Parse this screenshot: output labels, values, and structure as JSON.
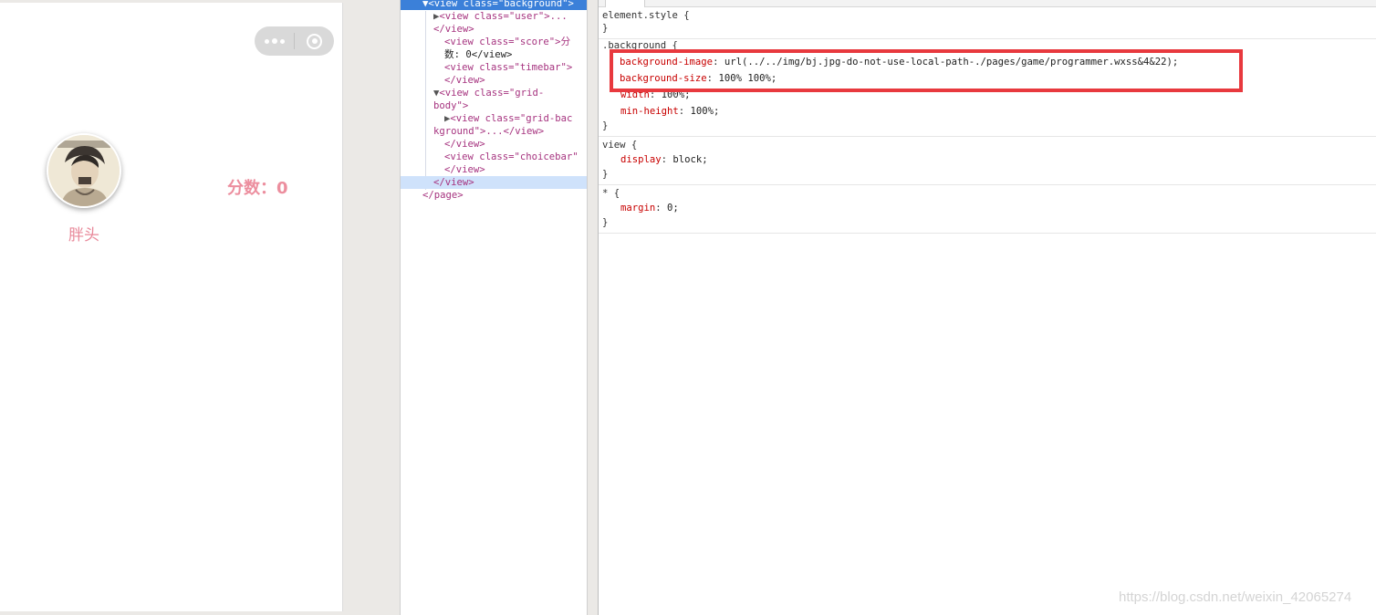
{
  "simulator": {
    "nickname": "胖头",
    "score_label": "分数：0"
  },
  "tree": {
    "rows": [
      "<view class=\"background\">",
      "<view class=\"user\">...",
      "</view>",
      "<view class=\"score\">分",
      "数: 0</view>",
      "<view class=\"timebar\">",
      "</view>",
      "<view class=\"grid-",
      "body\">",
      "<view class=\"grid-bac",
      "kground\">...</view>",
      "</view>",
      "<view class=\"choicebar\"",
      "</view>",
      "</view>",
      "</page>"
    ]
  },
  "styles": {
    "element_style": "element.style {",
    "close_brace": "}",
    "background_selector": ".background {",
    "bg_image_prop": "background-image",
    "bg_image_val": "url(../../img/bj.jpg-do-not-use-local-path-./pages/game/programmer.wxss&4&22);",
    "bg_size_prop": "background-size",
    "bg_size_val": "100% 100%;",
    "width_prop": "width",
    "width_val": "100%;",
    "minh_prop": "min-height",
    "minh_val": "100%;",
    "view_selector": "view {",
    "display_prop": "display",
    "display_val": "block;",
    "star_selector": "* {",
    "margin_prop": "margin",
    "margin_val": "0;"
  },
  "watermark": "https://blog.csdn.net/weixin_42065274",
  "colors": {
    "accent_pink": "#ec8e9e",
    "selection_blue": "#3b80d9",
    "highlight_red": "#e8393e"
  }
}
